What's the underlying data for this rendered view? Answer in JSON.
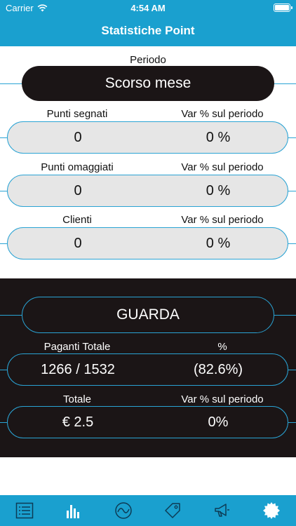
{
  "status_bar": {
    "carrier": "Carrier",
    "time": "4:54 AM",
    "wifi_icon": "wifi-icon",
    "battery_icon": "battery-icon"
  },
  "nav": {
    "title": "Statistiche Point"
  },
  "period": {
    "label": "Periodo",
    "value": "Scorso mese"
  },
  "stats": [
    {
      "left_label": "Punti segnati",
      "right_label": "Var % sul periodo",
      "left_value": "0",
      "right_value": "0 %"
    },
    {
      "left_label": "Punti omaggiati",
      "right_label": "Var % sul periodo",
      "left_value": "0",
      "right_value": "0 %"
    },
    {
      "left_label": "Clienti",
      "right_label": "Var % sul periodo",
      "left_value": "0",
      "right_value": "0 %"
    }
  ],
  "guarda": {
    "label": "GUARDA"
  },
  "dark_stats": [
    {
      "left_label": "Paganti Totale",
      "right_label": "%",
      "left_value": "1266 / 1532",
      "right_value": "(82.6%)"
    },
    {
      "left_label": "Totale",
      "right_label": "Var % sul periodo",
      "left_value": "€ 2.5",
      "right_value": "0%"
    }
  ],
  "tabbar": {
    "items": [
      {
        "icon": "list-icon",
        "active": false
      },
      {
        "icon": "bar-chart-icon",
        "active": true
      },
      {
        "icon": "trend-icon",
        "active": false
      },
      {
        "icon": "tag-icon",
        "active": false
      },
      {
        "icon": "megaphone-icon",
        "active": false
      },
      {
        "icon": "badge-icon",
        "active": false
      }
    ]
  },
  "colors": {
    "accent": "#1aa0cf",
    "dark": "#1b1516",
    "pill_light": "#e6e6e6",
    "border": "#2aa3d4"
  }
}
